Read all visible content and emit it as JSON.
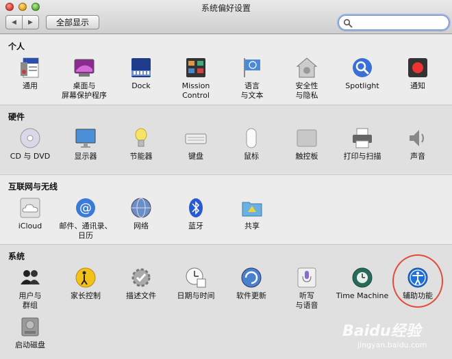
{
  "window": {
    "title": "系统偏好设置"
  },
  "toolbar": {
    "back": "◀",
    "forward": "▶",
    "show_all": "全部显示",
    "search_placeholder": "",
    "search_value": ""
  },
  "sections": [
    {
      "title": "个人",
      "items": [
        {
          "label": "通用",
          "icon": "general-icon"
        },
        {
          "label": "桌面与\n屏幕保护程序",
          "icon": "desktop-screensaver-icon"
        },
        {
          "label": "Dock",
          "icon": "dock-icon"
        },
        {
          "label": "Mission\nControl",
          "icon": "mission-control-icon"
        },
        {
          "label": "语言\n与文本",
          "icon": "language-text-icon"
        },
        {
          "label": "安全性\n与隐私",
          "icon": "security-privacy-icon"
        },
        {
          "label": "Spotlight",
          "icon": "spotlight-icon"
        },
        {
          "label": "通知",
          "icon": "notifications-icon"
        }
      ]
    },
    {
      "title": "硬件",
      "items": [
        {
          "label": "CD 与 DVD",
          "icon": "cd-dvd-icon"
        },
        {
          "label": "显示器",
          "icon": "displays-icon"
        },
        {
          "label": "节能器",
          "icon": "energy-saver-icon"
        },
        {
          "label": "键盘",
          "icon": "keyboard-icon"
        },
        {
          "label": "鼠标",
          "icon": "mouse-icon"
        },
        {
          "label": "触控板",
          "icon": "trackpad-icon"
        },
        {
          "label": "打印与扫描",
          "icon": "print-scan-icon"
        },
        {
          "label": "声音",
          "icon": "sound-icon"
        }
      ]
    },
    {
      "title": "互联网与无线",
      "items": [
        {
          "label": "iCloud",
          "icon": "icloud-icon"
        },
        {
          "label": "邮件、通讯录、\n日历",
          "icon": "mail-contacts-calendars-icon"
        },
        {
          "label": "网络",
          "icon": "network-icon"
        },
        {
          "label": "蓝牙",
          "icon": "bluetooth-icon"
        },
        {
          "label": "共享",
          "icon": "sharing-icon"
        }
      ]
    },
    {
      "title": "系统",
      "items": [
        {
          "label": "用户与\n群组",
          "icon": "users-groups-icon"
        },
        {
          "label": "家长控制",
          "icon": "parental-controls-icon"
        },
        {
          "label": "描述文件",
          "icon": "profiles-icon"
        },
        {
          "label": "日期与时间",
          "icon": "date-time-icon"
        },
        {
          "label": "软件更新",
          "icon": "software-update-icon"
        },
        {
          "label": "听写\n与语音",
          "icon": "dictation-speech-icon"
        },
        {
          "label": "Time Machine",
          "icon": "time-machine-icon"
        },
        {
          "label": "辅助功能",
          "icon": "accessibility-icon"
        },
        {
          "label": "启动磁盘",
          "icon": "startup-disk-icon"
        }
      ]
    }
  ],
  "watermark": {
    "brand": "Baidu经验",
    "url": "jingyan.baidu.com"
  },
  "colors": {
    "highlight": "#e44a3a",
    "accessibility_blue": "#1f6fd8"
  }
}
